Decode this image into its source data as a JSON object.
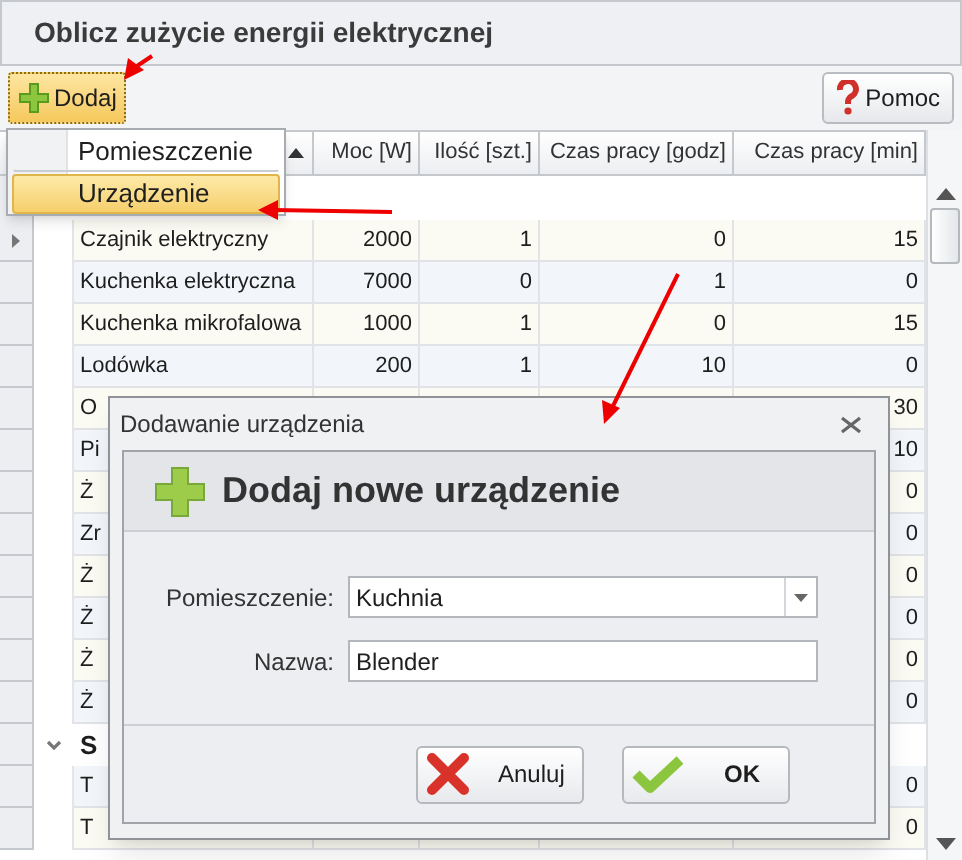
{
  "title": "Oblicz zużycie energii elektrycznej",
  "toolbar": {
    "add_button": "Dodaj",
    "help_button": "Pomoc"
  },
  "grid": {
    "columns": [
      "Moc [W]",
      "Ilość [szt.]",
      "Czas pracy [godz]",
      "Czas pracy [min]"
    ],
    "rows": [
      {
        "kind": "item",
        "current": true,
        "cells": [
          "Czajnik elektryczny",
          "2000",
          "1",
          "0",
          "15"
        ]
      },
      {
        "kind": "item",
        "current": false,
        "cells": [
          "Kuchenka elektryczna",
          "7000",
          "0",
          "1",
          "0"
        ]
      },
      {
        "kind": "item",
        "current": false,
        "cells": [
          "Kuchenka mikrofalowa",
          "1000",
          "1",
          "0",
          "15"
        ]
      },
      {
        "kind": "item",
        "current": false,
        "cells": [
          "Lodówka",
          "200",
          "1",
          "10",
          "0"
        ]
      },
      {
        "kind": "item",
        "current": false,
        "cells": [
          "O",
          null,
          null,
          null,
          "30"
        ]
      },
      {
        "kind": "item",
        "current": false,
        "cells": [
          "Pi",
          null,
          null,
          null,
          "10"
        ]
      },
      {
        "kind": "item",
        "current": false,
        "cells": [
          "Ż",
          null,
          null,
          null,
          "0"
        ]
      },
      {
        "kind": "item",
        "current": false,
        "cells": [
          "Zr",
          null,
          null,
          null,
          "0"
        ]
      },
      {
        "kind": "item",
        "current": false,
        "cells": [
          "Ż",
          null,
          null,
          null,
          "0"
        ]
      },
      {
        "kind": "item",
        "current": false,
        "cells": [
          "Ż",
          null,
          null,
          null,
          "0"
        ]
      },
      {
        "kind": "item",
        "current": false,
        "cells": [
          "Ż",
          null,
          null,
          null,
          "0"
        ]
      },
      {
        "kind": "item",
        "current": false,
        "cells": [
          "Ż",
          null,
          null,
          null,
          "0"
        ]
      },
      {
        "kind": "group",
        "expanded": true,
        "label": "S"
      },
      {
        "kind": "item",
        "current": false,
        "cells": [
          "T",
          null,
          null,
          null,
          "0"
        ]
      },
      {
        "kind": "item",
        "current": false,
        "cells": [
          "T",
          null,
          null,
          null,
          "0"
        ]
      }
    ]
  },
  "menu": {
    "items": [
      {
        "label": "Pomieszczenie",
        "selected": false
      },
      {
        "label": "Urządzenie",
        "selected": true
      }
    ]
  },
  "dialog": {
    "title": "Dodawanie urządzenia",
    "heading": "Dodaj nowe urządzenie",
    "fields": [
      {
        "kind": "combo",
        "label": "Pomieszczenie:",
        "value": "Kuchnia"
      },
      {
        "kind": "text",
        "label": "Nazwa:",
        "value": "Blender"
      }
    ],
    "buttons": [
      {
        "kind": "cancel",
        "label": "Anuluj"
      },
      {
        "kind": "ok",
        "label": "OK"
      }
    ]
  }
}
